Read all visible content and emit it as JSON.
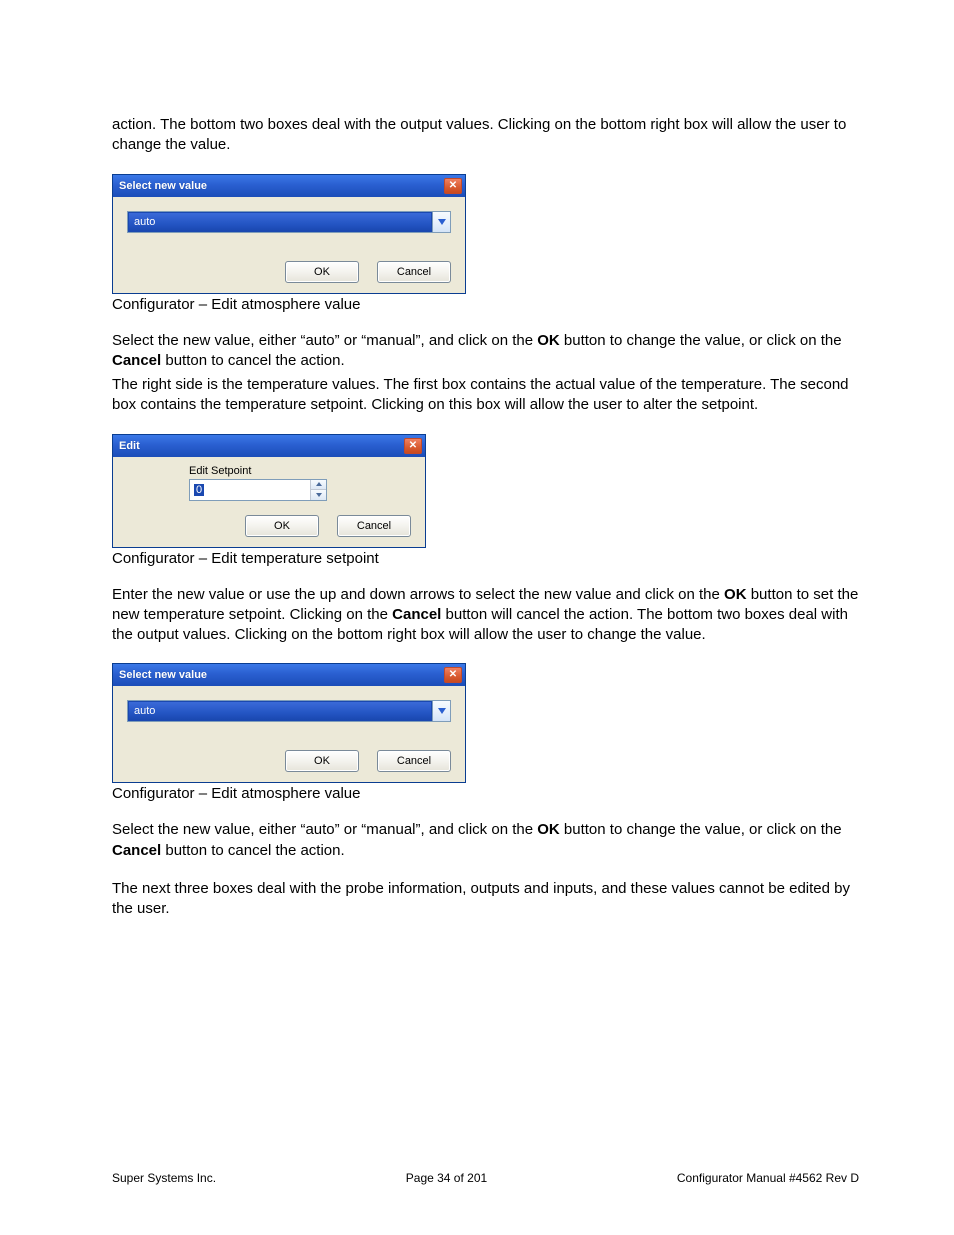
{
  "paragraphs": {
    "p1": "action.  The bottom two boxes deal with the output values.  Clicking on the bottom right box will allow the user to change the value.",
    "p2a": "Select the new value, either “auto” or “manual”, and click on the ",
    "p2b": " button to change the value, or click on the ",
    "p2c": " button to cancel the action.",
    "p3": "The right side is the temperature values.  The first box contains the actual value of the temperature.  The second box contains the temperature setpoint.  Clicking on this box will allow the user to alter the setpoint.",
    "p4a": "Enter the new value or use the up and down arrows to select the new value and click on the ",
    "p4b": " button to set the new temperature setpoint.  Clicking on the ",
    "p4c": " button will cancel the action.  The bottom two boxes deal with the output values.  Clicking on the bottom right box will allow the user to change the value.",
    "p5a": "Select the new value, either “auto” or “manual”, and click on the ",
    "p5b": " button to change the value, or click on the ",
    "p5c": " button to cancel the action.",
    "p6": "The next three boxes deal with the probe information, outputs and inputs, and these values cannot be edited by the user."
  },
  "bold": {
    "ok": "OK",
    "cancel": "Cancel"
  },
  "captions": {
    "c1": "Configurator – Edit atmosphere value",
    "c2": "Configurator – Edit temperature setpoint",
    "c3": "Configurator – Edit atmosphere value"
  },
  "dialog1": {
    "title": "Select new value",
    "combo_value": "auto",
    "ok": "OK",
    "cancel": "Cancel"
  },
  "dialog2": {
    "title": "Edit",
    "label": "Edit Setpoint",
    "value": "0",
    "ok": "OK",
    "cancel": "Cancel"
  },
  "dialog3": {
    "title": "Select new value",
    "combo_value": "auto",
    "ok": "OK",
    "cancel": "Cancel"
  },
  "footer": {
    "left": "Super Systems Inc.",
    "center": "Page 34 of 201",
    "right": "Configurator Manual #4562 Rev D"
  }
}
